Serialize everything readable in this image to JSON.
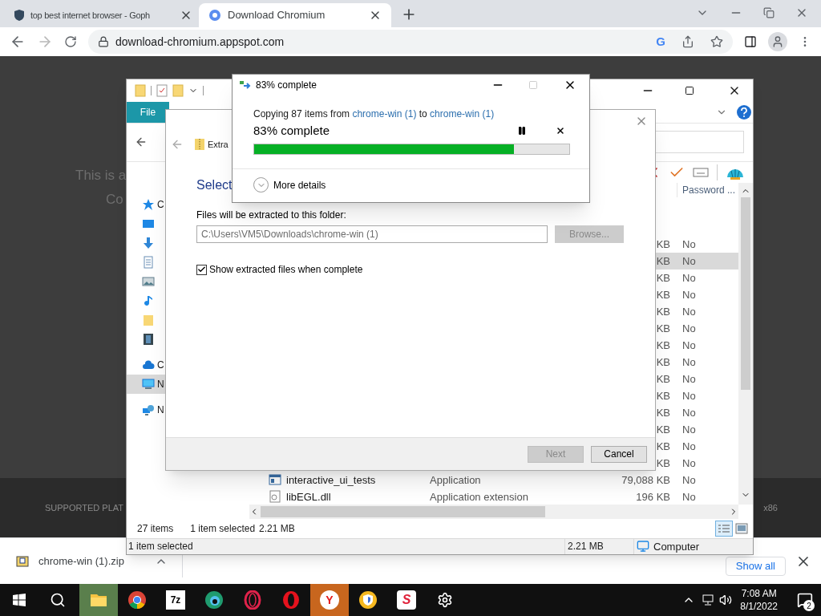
{
  "browser": {
    "tabs": [
      {
        "title": "top best internet browser - Goph",
        "selected": false
      },
      {
        "title": "Download Chromium",
        "selected": true
      }
    ],
    "address": "download-chromium.appspot.com",
    "google_letter": "G"
  },
  "page": {
    "lines": [
      "This is a",
      "Co"
    ],
    "footer": "SUPPORTED PLAT",
    "footer_right": "x86"
  },
  "explorer": {
    "ribbon_tab": "File",
    "nav_items": [
      {
        "kind": "star",
        "label": "C",
        "selected": false
      },
      {
        "kind": "desktop",
        "selected": false
      },
      {
        "kind": "download",
        "selected": false
      },
      {
        "kind": "document",
        "selected": false
      },
      {
        "kind": "pictures",
        "selected": false
      },
      {
        "kind": "music",
        "selected": false
      },
      {
        "kind": "folder",
        "selected": false
      },
      {
        "kind": "video",
        "selected": false
      },
      {
        "kind": "cloud",
        "label": "C",
        "selected": false
      },
      {
        "kind": "computer",
        "label": "N",
        "selected": true
      },
      {
        "kind": "network",
        "label": "N",
        "selected": false
      }
    ],
    "column_header": "Password ...",
    "rows": [
      {
        "size": "KB",
        "attr": "No",
        "selected": false
      },
      {
        "size": "KB",
        "attr": "No",
        "selected": true
      },
      {
        "size": "KB",
        "attr": "No",
        "selected": false
      },
      {
        "size": "KB",
        "attr": "No",
        "selected": false
      },
      {
        "size": "KB",
        "attr": "No",
        "selected": false
      },
      {
        "size": "KB",
        "attr": "No",
        "selected": false
      },
      {
        "size": "KB",
        "attr": "No",
        "selected": false
      },
      {
        "size": "KB",
        "attr": "No",
        "selected": false
      },
      {
        "size": "KB",
        "attr": "No",
        "selected": false
      },
      {
        "size": "KB",
        "attr": "No",
        "selected": false
      },
      {
        "size": "KB",
        "attr": "No",
        "selected": false
      },
      {
        "size": "KB",
        "attr": "No",
        "selected": false
      },
      {
        "size": "KB",
        "attr": "No",
        "selected": false
      },
      {
        "size": "KB",
        "attr": "No",
        "selected": false
      },
      {
        "kind": "app",
        "name": "interactive_ui_tests",
        "type": "Application",
        "size": "79,088 KB",
        "attr": "No",
        "selected": false
      },
      {
        "kind": "dll",
        "name": "libEGL.dll",
        "type": "Application extension",
        "size": "196 KB",
        "attr": "No",
        "selected": false
      }
    ],
    "item_count": "27 items",
    "selection": "1 item selected",
    "selection_size": "2.21 MB",
    "statusbar": {
      "selection": "1 item selected",
      "size": "2.21 MB",
      "zone": "Computer"
    }
  },
  "extract": {
    "title": "Extra",
    "heading": "Select",
    "folder_label": "Files will be extracted to this folder:",
    "folder_value": "C:\\Users\\VM5\\Downloads\\chrome-win (1)",
    "browse": {
      "label": "Browse...",
      "disabled": true
    },
    "show_files": {
      "label": "Show extracted files when complete",
      "checked": true
    },
    "next": {
      "label": "Next",
      "disabled": true
    },
    "cancel": {
      "label": "Cancel",
      "disabled": false
    }
  },
  "copy": {
    "title": "83% complete",
    "maximize_disabled": true,
    "copying_prefix": "Copying 87 items from",
    "source": "chrome-win (1)",
    "to": "to",
    "destination": "chrome-win (1)",
    "status": "83% complete",
    "level": 0.825,
    "details": "More details"
  },
  "download": {
    "file": "chrome-win (1).zip",
    "show_all": "Show all"
  },
  "taskbar": {
    "apps": [
      {
        "kind": "explorer",
        "color": "#5a7f4c"
      },
      {
        "kind": "chrome"
      },
      {
        "kind": "sevenzip",
        "label": "7z"
      },
      {
        "kind": "edge"
      },
      {
        "kind": "operagx"
      },
      {
        "kind": "opera"
      },
      {
        "kind": "yandex",
        "label": "Y",
        "color": "#c8661e"
      },
      {
        "kind": "shield"
      },
      {
        "kind": "sapp",
        "label": "S"
      },
      {
        "kind": "settings"
      }
    ],
    "time": "7:08 AM",
    "date": "8/1/2022",
    "notifications": "2"
  }
}
